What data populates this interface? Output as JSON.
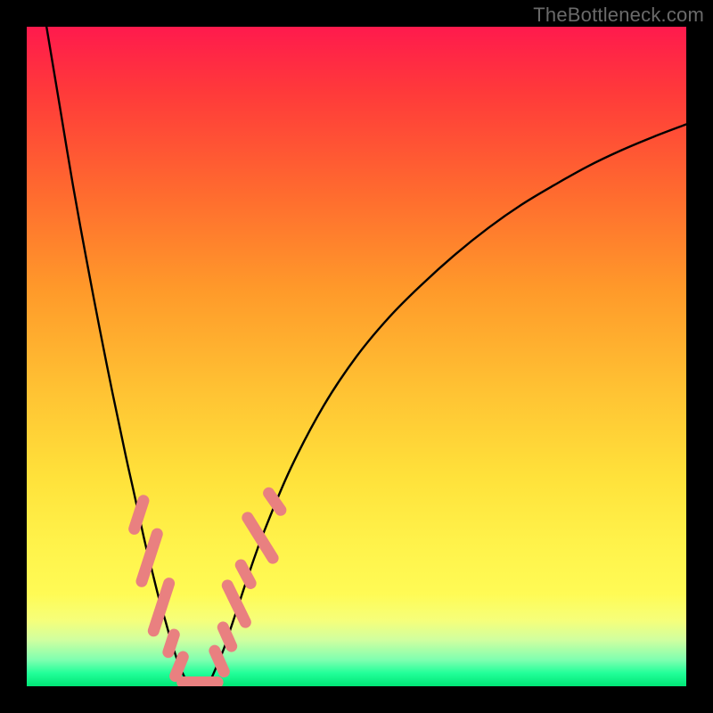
{
  "watermark": "TheBottleneck.com",
  "chart_data": {
    "type": "line",
    "title": "",
    "xlabel": "",
    "ylabel": "",
    "xlim": [
      0,
      100
    ],
    "ylim": [
      0,
      100
    ],
    "series": [
      {
        "name": "left-branch",
        "x": [
          3,
          5,
          7,
          9,
          11,
          13,
          15,
          16,
          17,
          18,
          19,
          20,
          21,
          22,
          23,
          24
        ],
        "y": [
          100,
          88,
          76,
          65,
          54.5,
          44.5,
          35,
          30.5,
          26,
          21.5,
          17.5,
          13.5,
          10,
          6.5,
          3.5,
          1.2
        ]
      },
      {
        "name": "right-branch",
        "x": [
          28,
          29,
          30,
          31,
          32,
          34,
          36,
          40,
          45,
          50,
          55,
          60,
          65,
          70,
          75,
          80,
          85,
          90,
          95,
          100
        ],
        "y": [
          1.2,
          3.5,
          6,
          9,
          12,
          18,
          23.5,
          33,
          42.5,
          50,
          56,
          61,
          65.5,
          69.5,
          73,
          76,
          78.8,
          81.2,
          83.3,
          85.2
        ]
      },
      {
        "name": "valley-floor",
        "x": [
          24,
          25,
          26,
          27,
          28
        ],
        "y": [
          1.2,
          0.4,
          0.2,
          0.4,
          1.2
        ]
      }
    ],
    "markers": {
      "name": "beads",
      "shape": "rounded-rect",
      "color": "#e98080",
      "points": [
        {
          "x": 17.0,
          "y": 26.0,
          "len": 3.2,
          "angle": -72
        },
        {
          "x": 18.6,
          "y": 19.5,
          "len": 5.0,
          "angle": -72
        },
        {
          "x": 20.4,
          "y": 12.0,
          "len": 5.0,
          "angle": -72
        },
        {
          "x": 21.9,
          "y": 6.5,
          "len": 2.2,
          "angle": -72
        },
        {
          "x": 23.1,
          "y": 3.0,
          "len": 2.4,
          "angle": -68
        },
        {
          "x": 25.0,
          "y": 0.6,
          "len": 2.2,
          "angle": 0
        },
        {
          "x": 27.2,
          "y": 0.6,
          "len": 2.6,
          "angle": 0
        },
        {
          "x": 29.2,
          "y": 3.8,
          "len": 2.6,
          "angle": 66
        },
        {
          "x": 30.4,
          "y": 7.5,
          "len": 2.4,
          "angle": 66
        },
        {
          "x": 31.8,
          "y": 12.5,
          "len": 4.2,
          "angle": 64
        },
        {
          "x": 33.2,
          "y": 17.0,
          "len": 2.4,
          "angle": 62
        },
        {
          "x": 35.4,
          "y": 22.5,
          "len": 4.8,
          "angle": 58
        },
        {
          "x": 37.6,
          "y": 28.0,
          "len": 2.4,
          "angle": 55
        }
      ]
    }
  }
}
